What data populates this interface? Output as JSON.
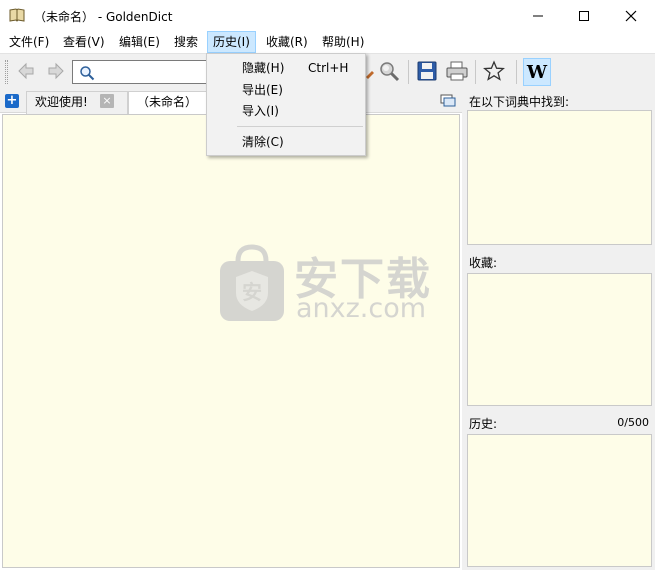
{
  "window": {
    "title": "（未命名） - GoldenDict",
    "minimize_glyph": "—",
    "maximize_glyph": "☐",
    "close_glyph": "✕"
  },
  "menubar": {
    "items": [
      {
        "label": "文件(F)"
      },
      {
        "label": "查看(V)"
      },
      {
        "label": "编辑(E)"
      },
      {
        "label": "搜索"
      },
      {
        "label": "历史(I)"
      },
      {
        "label": "收藏(R)"
      },
      {
        "label": "帮助(H)"
      }
    ]
  },
  "history_menu": {
    "items": [
      {
        "label": "隐藏(H)",
        "shortcut": "Ctrl+H"
      },
      {
        "label": "导出(E)",
        "shortcut": ""
      },
      {
        "label": "导入(I)",
        "shortcut": ""
      },
      {
        "label": "清除(C)",
        "shortcut": ""
      }
    ]
  },
  "toolbar": {
    "search": {
      "value": "",
      "placeholder": ""
    },
    "wiki_label": "W",
    "icons": [
      "back-arrow-icon",
      "forward-arrow-icon",
      "search-icon",
      "zoom-icon",
      "save-icon",
      "print-icon",
      "favorite-star-icon",
      "wikipedia-icon"
    ]
  },
  "tabs": {
    "add_glyph": "+",
    "close_glyph": "×",
    "items": [
      {
        "label": "欢迎使用!"
      },
      {
        "label": "（未命名）"
      }
    ]
  },
  "side": {
    "found_label": "在以下词典中找到:",
    "favorites_label": "收藏:",
    "history_label": "历史:",
    "history_count": "0/500"
  },
  "watermark": {
    "chinese": "安下载",
    "domain": "anxz.com",
    "bag_glyph": "安"
  },
  "colors": {
    "article_bg": "#fefde8",
    "menu_highlight": "#cce8ff",
    "panel_bg": "#f0f0f0",
    "accent_blue": "#1b6ac9"
  }
}
